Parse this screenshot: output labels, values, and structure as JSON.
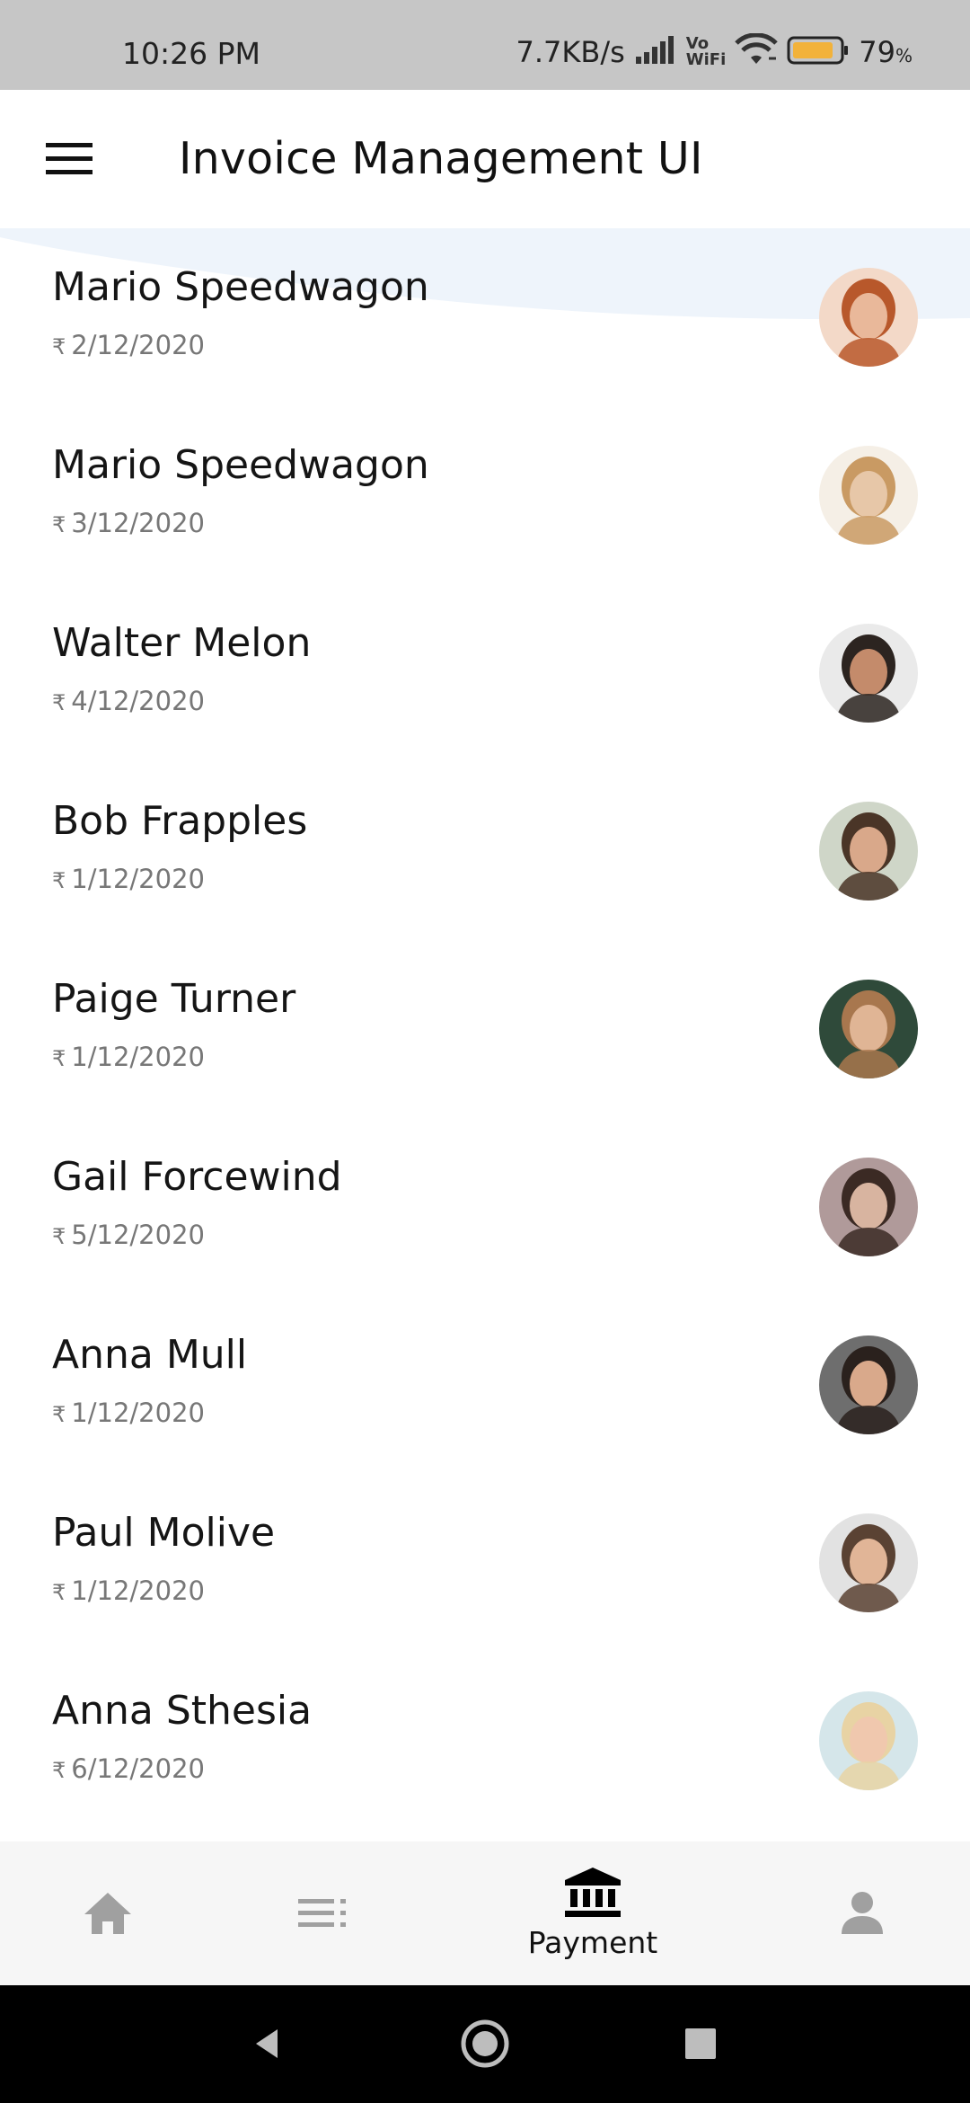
{
  "status_bar": {
    "time": "10:26 PM",
    "net_speed": "7.7KB/s",
    "vowifi_top": "Vo",
    "vowifi_bottom": "WiFi",
    "battery_percent": "79",
    "battery_unit": "%",
    "icons": [
      "signal-icon",
      "vowifi-icon",
      "wifi-icon",
      "battery-icon"
    ]
  },
  "app_bar": {
    "menu_icon": "hamburger-menu-icon",
    "title": "Invoice Management UI"
  },
  "currency_symbol": "₹",
  "invoices": [
    {
      "name": "Mario Speedwagon",
      "date": "2/12/2020",
      "avatar": "avatar-photo"
    },
    {
      "name": "Mario Speedwagon",
      "date": "3/12/2020",
      "avatar": "avatar-photo"
    },
    {
      "name": "Walter Melon",
      "date": "4/12/2020",
      "avatar": "avatar-photo"
    },
    {
      "name": "Bob Frapples",
      "date": "1/12/2020",
      "avatar": "avatar-photo"
    },
    {
      "name": "Paige Turner",
      "date": "1/12/2020",
      "avatar": "avatar-photo"
    },
    {
      "name": "Gail Forcewind",
      "date": "5/12/2020",
      "avatar": "avatar-photo"
    },
    {
      "name": "Anna Mull",
      "date": "1/12/2020",
      "avatar": "avatar-photo"
    },
    {
      "name": "Paul Molive",
      "date": "1/12/2020",
      "avatar": "avatar-photo"
    },
    {
      "name": "Anna Sthesia",
      "date": "6/12/2020",
      "avatar": "avatar-photo"
    }
  ],
  "bottom_nav": {
    "items": [
      {
        "icon": "home-icon",
        "label": "",
        "active": false
      },
      {
        "icon": "list-icon",
        "label": "",
        "active": false
      },
      {
        "icon": "bank-icon",
        "label": "Payment",
        "active": true
      },
      {
        "icon": "person-icon",
        "label": "",
        "active": false
      }
    ],
    "active_color": "#000000",
    "inactive_color": "#9e9e9e"
  },
  "system_nav": {
    "icons": [
      "back-icon",
      "home-circle-icon",
      "recents-icon"
    ]
  },
  "colors": {
    "status_bar_bg": "#c6c6c6",
    "app_bar_bg": "#ffffff",
    "wave_tint": "#eef4fb",
    "bottom_nav_bg": "#f6f6f6",
    "battery_fill": "#f2b23a"
  }
}
